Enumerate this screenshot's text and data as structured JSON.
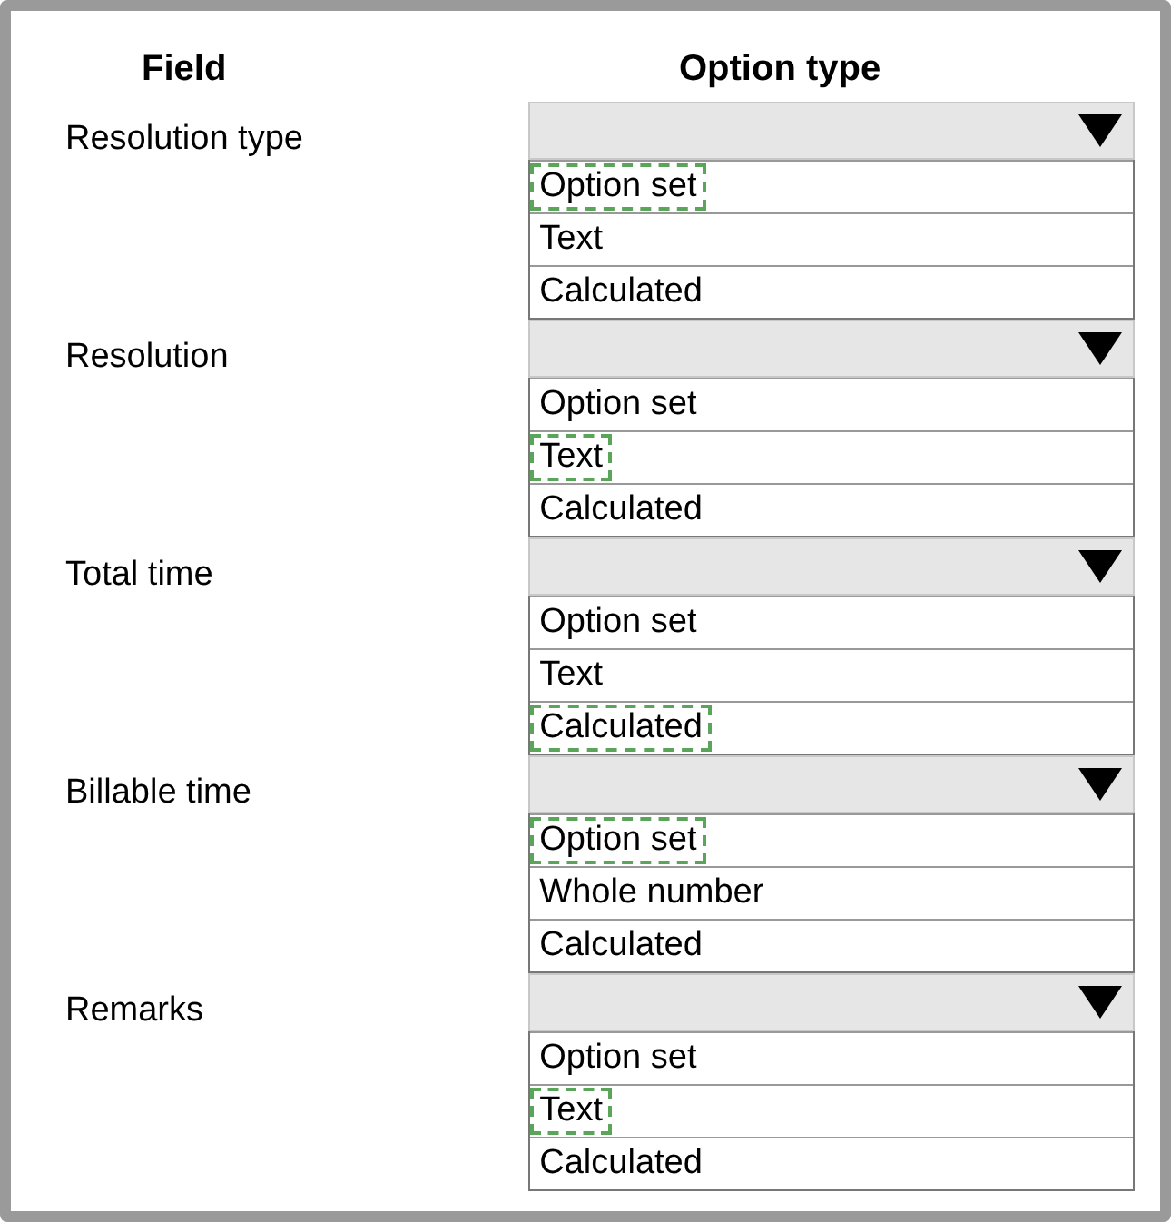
{
  "headers": {
    "field": "Field",
    "option_type": "Option type"
  },
  "rows": [
    {
      "field": "Resolution type",
      "options": [
        {
          "label": "Option set",
          "selected": true
        },
        {
          "label": "Text",
          "selected": false
        },
        {
          "label": "Calculated",
          "selected": false
        }
      ]
    },
    {
      "field": "Resolution",
      "options": [
        {
          "label": "Option set",
          "selected": false
        },
        {
          "label": "Text",
          "selected": true
        },
        {
          "label": "Calculated",
          "selected": false
        }
      ]
    },
    {
      "field": "Total time",
      "options": [
        {
          "label": "Option set",
          "selected": false
        },
        {
          "label": "Text",
          "selected": false
        },
        {
          "label": "Calculated",
          "selected": true
        }
      ]
    },
    {
      "field": "Billable time",
      "options": [
        {
          "label": "Option set",
          "selected": true
        },
        {
          "label": "Whole number",
          "selected": false
        },
        {
          "label": "Calculated",
          "selected": false
        }
      ]
    },
    {
      "field": "Remarks",
      "options": [
        {
          "label": "Option set",
          "selected": false
        },
        {
          "label": "Text",
          "selected": true
        },
        {
          "label": "Calculated",
          "selected": false
        }
      ]
    }
  ]
}
